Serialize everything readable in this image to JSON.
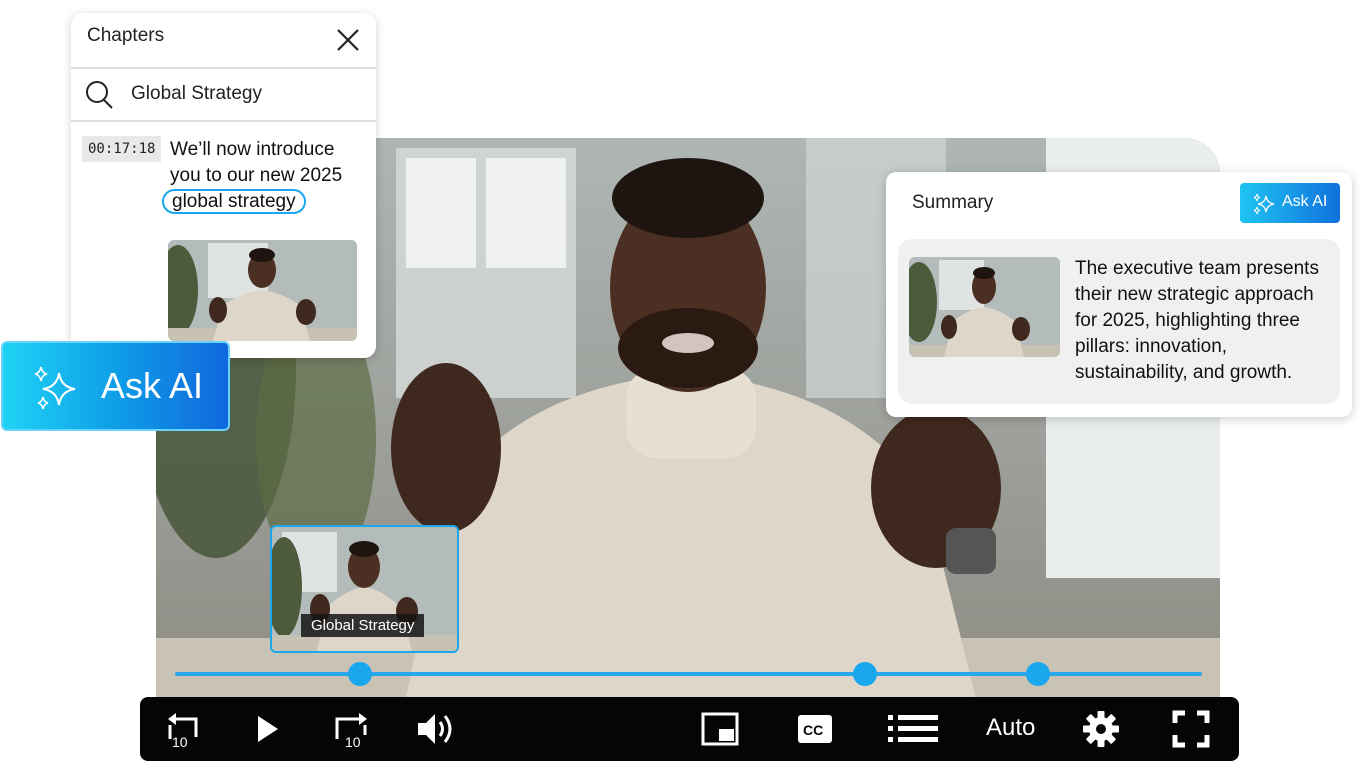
{
  "chapters": {
    "title": "Chapters",
    "search_value": "Global Strategy",
    "entry": {
      "timestamp": "00:17:18",
      "text_before": "We’ll now introduce you to our new 2025",
      "highlight": "global strategy"
    }
  },
  "ask_ai_large": {
    "label": "Ask AI",
    "icon": "sparkles-icon"
  },
  "summary": {
    "title": "Summary",
    "ask_button_label": "Ask AI",
    "text": "The executive team presents their new strategic approach for 2025, highlighting three pillars: innovation, sustainability, and growth."
  },
  "preview": {
    "label": "Global Strategy"
  },
  "player": {
    "quality_label": "Auto",
    "chapter_markers": 3,
    "icons": [
      "rewind-10-icon",
      "play-icon",
      "forward-10-icon",
      "volume-icon",
      "picture-in-picture-icon",
      "closed-captions-icon",
      "chapters-list-icon",
      "settings-gear-icon",
      "fullscreen-icon"
    ],
    "rewind_seconds": "10",
    "forward_seconds": "10",
    "cc_label": "CC"
  },
  "colors": {
    "accent": "#1aa7ee",
    "control_bar": "#050505",
    "gradient_start": "#1fd3f5",
    "gradient_end": "#1067dc"
  }
}
